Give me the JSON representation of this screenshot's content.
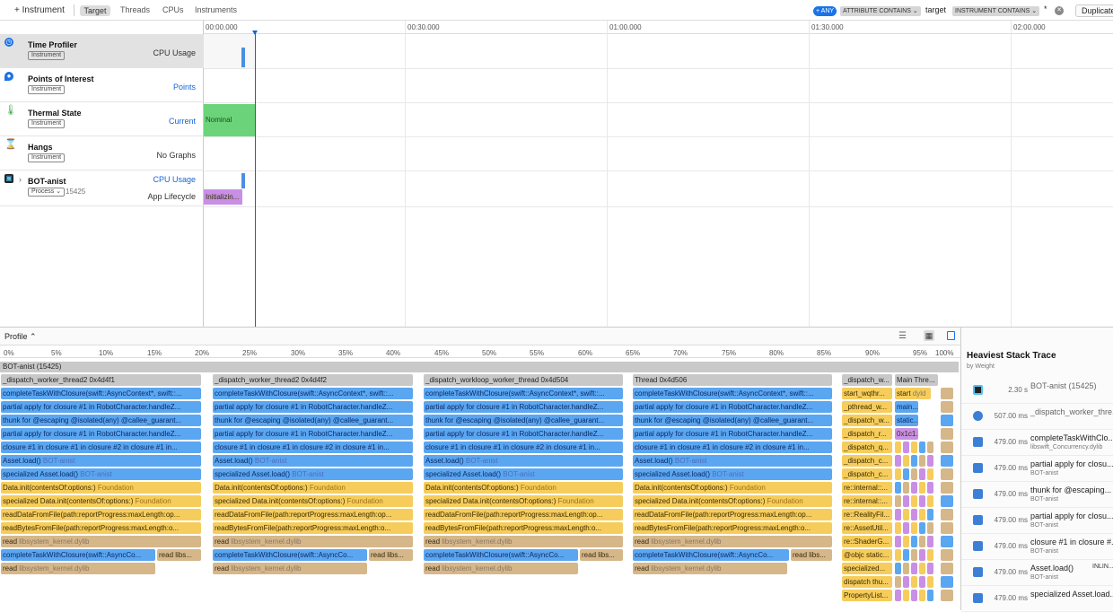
{
  "toolbar": {
    "add_instrument": "+ Instrument",
    "tabs": [
      "Target",
      "Threads",
      "CPUs",
      "Instruments"
    ],
    "filter": {
      "any": "+ ANY",
      "attr": "ATTRIBUTE CONTAINS ⌄",
      "target": "target",
      "instr": "INSTRUMENT CONTAINS ⌄",
      "star": "*"
    },
    "duplicate": "Duplicate"
  },
  "tracks": [
    {
      "name": "Time Profiler",
      "badge": "Instrument",
      "right": "CPU Usage"
    },
    {
      "name": "Points of Interest",
      "badge": "Instrument",
      "right": "Points"
    },
    {
      "name": "Thermal State",
      "badge": "Instrument",
      "right": "Current"
    },
    {
      "name": "Hangs",
      "badge": "Instrument",
      "right": "No Graphs"
    },
    {
      "name": "BOT-anist",
      "badge": "Process ⌄",
      "pid": "15425",
      "right": "CPU Usage",
      "right2": "App Lifecycle"
    }
  ],
  "ruler": [
    "00:00.000",
    "00:30.000",
    "01:00.000",
    "01:30.000",
    "02:00.000"
  ],
  "thermal_label": "Nominal",
  "lifecycle_label": "Initializin...",
  "profile_label": "Profile ⌃",
  "pct_ticks": [
    "0%",
    "5%",
    "10%",
    "15%",
    "20%",
    "25%",
    "30%",
    "35%",
    "40%",
    "45%",
    "50%",
    "55%",
    "60%",
    "65%",
    "70%",
    "75%",
    "80%",
    "85%",
    "90%",
    "95%",
    "100%"
  ],
  "root": "BOT-anist (15425)",
  "threads": [
    "_dispatch_worker_thread2  0x4d4f1",
    "_dispatch_worker_thread2  0x4d4f2",
    "_dispatch_workloop_worker_thread  0x4d504",
    "Thread  0x4d506",
    "_dispatch_w...",
    "Main Thre..."
  ],
  "frames": {
    "f1": "completeTaskWithClosure(swift::AsyncContext*, swift::...",
    "f2": "partial apply for closure #1 in RobotCharacter.handleZ...",
    "f3": "thunk for @escaping @isolated(any) @callee_guarant...",
    "f4": "partial apply for closure #1 in RobotCharacter.handleZ...",
    "f5": "closure #1 in closure #1 in closure #2 in closure #1 in...",
    "f6": "Asset.load()",
    "f6l": "BOT-anist",
    "f7": "specialized Asset.load()",
    "f7l": "BOT-anist",
    "f8": "Data.init(contentsOf:options:)",
    "f8l": "Foundation",
    "f9": "specialized Data.init(contentsOf:options:)",
    "f9l": "Foundation",
    "f10": "readDataFromFile(path:reportProgress:maxLength:op...",
    "f11": "readBytesFromFile(path:reportProgress:maxLength:o...",
    "f12": "read",
    "f12l": "libsystem_kernel.dylib",
    "f13": "completeTaskWithClosure(swift::AsyncCo...",
    "f13b": "read libs...",
    "f14": "read",
    "f14l": "libsystem_kernel.dylib"
  },
  "narrow": [
    "start_wqthr...",
    "_pthread_w...",
    "_dispatch_w...",
    "_dispatch_r...",
    "_dispatch_q...",
    "_dispatch_c...",
    "_dispatch_c...",
    "re::internal::...",
    "re::internal::...",
    "re::RealityFil...",
    "re::AssetUtil...",
    "re::ShaderG...",
    "@objc static...",
    "specialized...",
    "dispatch thu...",
    "PropertyList..."
  ],
  "narrow2": [
    "start",
    "main...",
    "static...",
    "0x1c1..."
  ],
  "narrow2b": "dyld",
  "side": {
    "title": "Heaviest Stack Trace",
    "subtitle": "by Weight",
    "rows": [
      {
        "w": "2.30 s",
        "n": "BOT-anist (15425)",
        "l": ""
      },
      {
        "w": "507.00 ms",
        "n": "_dispatch_worker_thre...",
        "l": ""
      },
      {
        "w": "479.00 ms",
        "n": "completeTaskWithClo...",
        "l": "libswift_Concurrency.dylib"
      },
      {
        "w": "479.00 ms",
        "n": "partial apply for closu...",
        "l": "BOT-anist"
      },
      {
        "w": "479.00 ms",
        "n": "thunk for @escaping...",
        "l": "BOT-anist"
      },
      {
        "w": "479.00 ms",
        "n": "partial apply for closu...",
        "l": "BOT-anist"
      },
      {
        "w": "479.00 ms",
        "n": "closure #1 in closure #...",
        "l": "BOT-anist"
      },
      {
        "w": "479.00 ms",
        "n": "Asset.load()",
        "l": "BOT-anist",
        "tag": "INLIN..."
      },
      {
        "w": "479.00 ms",
        "n": "specialized Asset.load...",
        "l": ""
      }
    ]
  }
}
